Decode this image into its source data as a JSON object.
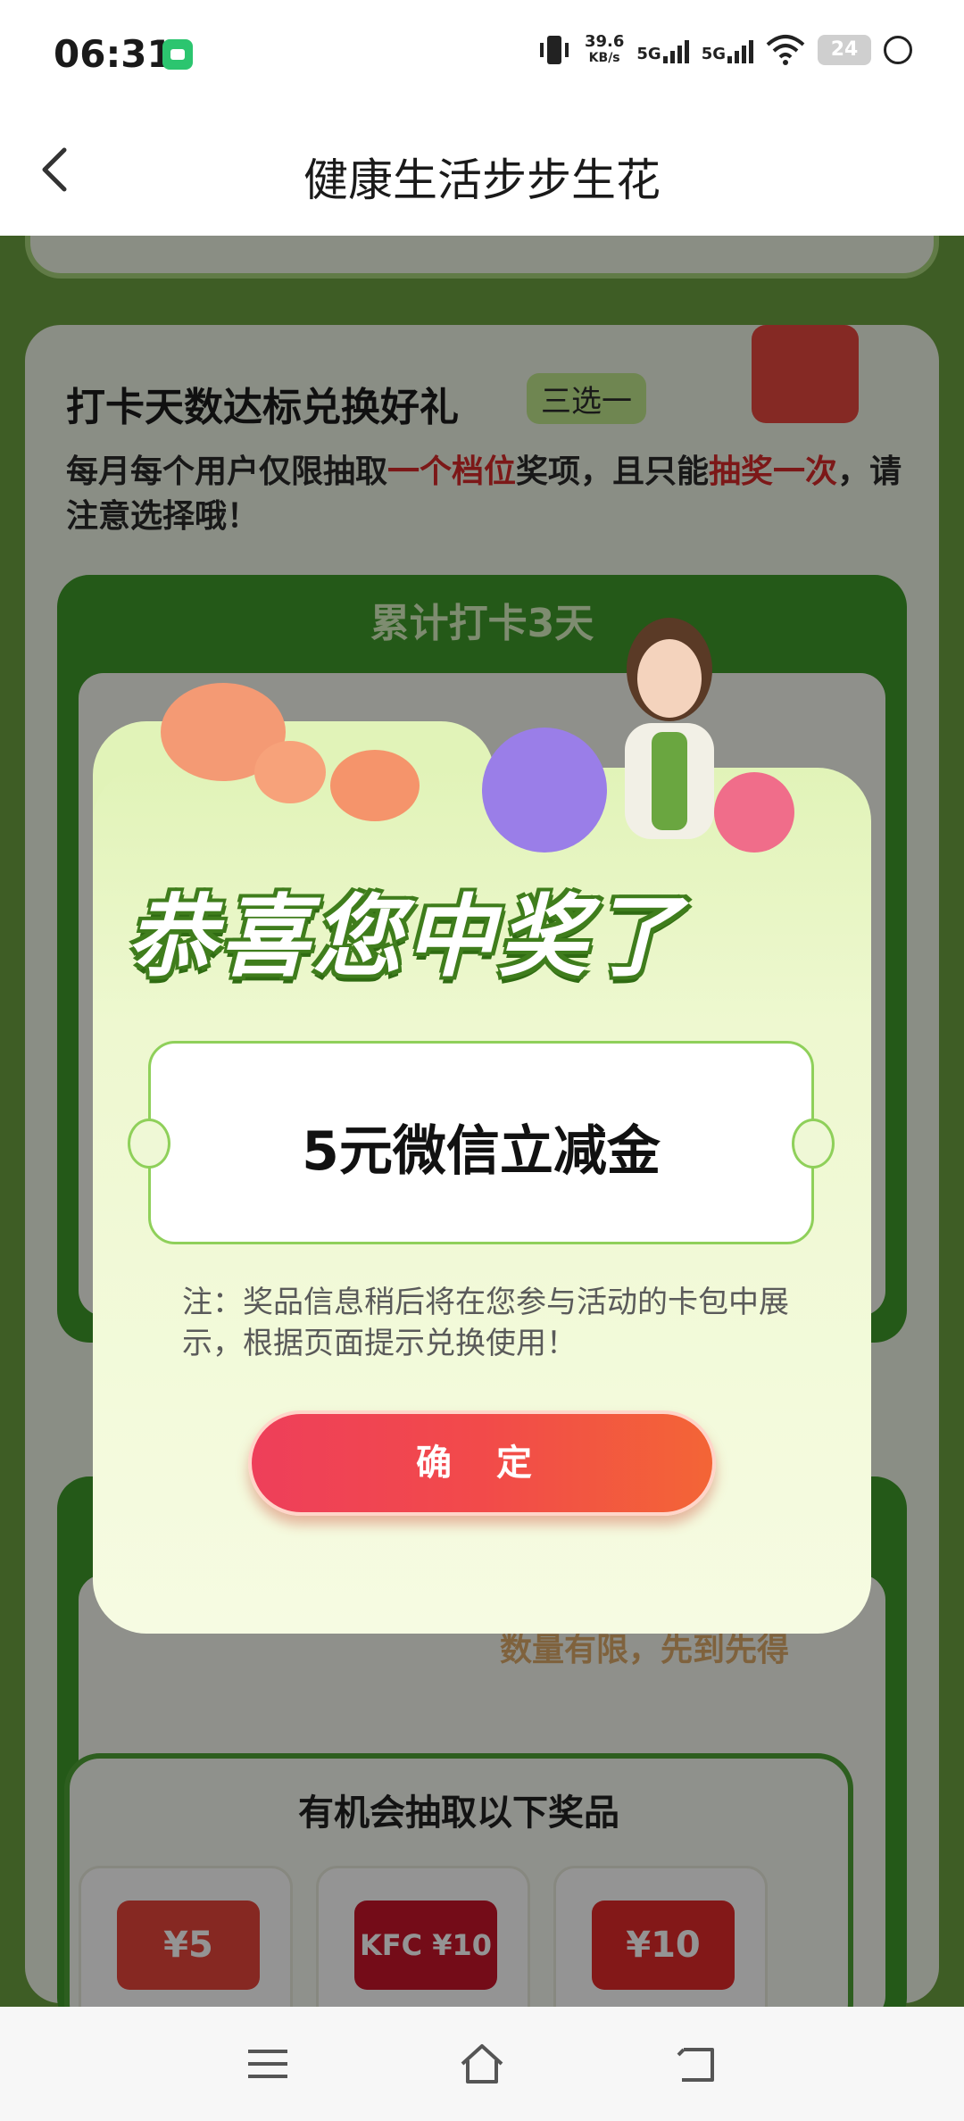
{
  "status_bar": {
    "time": "06:31",
    "net_speed_value": "39.6",
    "net_speed_unit": "KB/s",
    "signal1_label": "5G",
    "signal2_label": "5G",
    "battery": "24"
  },
  "header": {
    "title": "健康生活步步生花"
  },
  "section": {
    "title": "打卡天数达标兑换好礼",
    "tag": "三选一",
    "desc_part1": "每月每个用户仅限抽取",
    "desc_highlight1": "一个档位",
    "desc_part2": "奖项，且只能",
    "desc_highlight2": "抽奖一次",
    "desc_part3": "，请注意选择哦！",
    "tier_heading": "累计打卡3天",
    "limited_text": "数量有限，先到先得",
    "prizes_title": "有机会抽取以下奖品",
    "prizes": [
      {
        "label": "¥5"
      },
      {
        "label": "KFC ¥10"
      },
      {
        "label": "¥10"
      }
    ]
  },
  "dialog": {
    "headline": "恭喜您中奖了",
    "prize_name": "5元微信立减金",
    "note": "注：奖品信息稍后将在您参与活动的卡包中展示，根据页面提示兑换使用！",
    "confirm_label": "确 定"
  },
  "colors": {
    "accent_green": "#3f9a2a",
    "confirm_red": "#f24a4a",
    "highlight_red": "#d62a2a"
  }
}
